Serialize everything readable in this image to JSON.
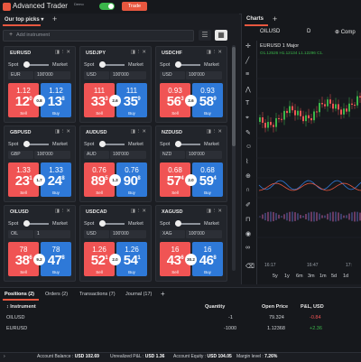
{
  "app": {
    "title": "Advanced Trader",
    "subtitle": "Demo",
    "trade_label": "Trade"
  },
  "watchlist": {
    "tab_label": "Our top picks",
    "add_tab": "+",
    "search_placeholder": "Add instrument",
    "tiles": [
      {
        "symbol": "EURUSD",
        "spot": "Spot",
        "market": "Market",
        "instrument": "EUR",
        "quantity": "100'000",
        "sell_top": "1.12",
        "sell_big": "12",
        "sell_small": "0",
        "buy_top": "1.12",
        "buy_big": "13",
        "buy_small": "8",
        "spread": "0.8",
        "sell_label": "Sell",
        "buy_label": "Buy"
      },
      {
        "symbol": "USDJPY",
        "spot": "Spot",
        "market": "Market",
        "instrument": "USD",
        "quantity": "100'000",
        "sell_top": "111",
        "sell_big": "33",
        "sell_small": "3",
        "buy_top": "111",
        "buy_big": "35",
        "buy_small": "9",
        "spread": "2.6",
        "sell_label": "Sell",
        "buy_label": "Buy"
      },
      {
        "symbol": "USDCHF",
        "spot": "Spot",
        "market": "Market",
        "instrument": "USD",
        "quantity": "100'000",
        "sell_top": "0.93",
        "sell_big": "56",
        "sell_small": "3",
        "buy_top": "0.93",
        "buy_big": "58",
        "buy_small": "9",
        "spread": "2.6",
        "sell_label": "Sell",
        "buy_label": "Buy"
      },
      {
        "symbol": "GBPUSD",
        "spot": "Spot",
        "market": "Market",
        "instrument": "GBP",
        "quantity": "100'000",
        "sell_top": "1.33",
        "sell_big": "23",
        "sell_small": "1",
        "buy_top": "1.33",
        "buy_big": "24",
        "buy_small": "8",
        "spread": "1.7",
        "sell_label": "Sell",
        "buy_label": "Buy"
      },
      {
        "symbol": "AUDUSD",
        "spot": "Spot",
        "market": "Market",
        "instrument": "AUD",
        "quantity": "100'000",
        "sell_top": "0.76",
        "sell_big": "89",
        "sell_small": "5",
        "buy_top": "0.76",
        "buy_big": "90",
        "buy_small": "8",
        "spread": "1.3",
        "sell_label": "Sell",
        "buy_label": "Buy"
      },
      {
        "symbol": "NZDUSD",
        "spot": "Spot",
        "market": "Market",
        "instrument": "NZD",
        "quantity": "100'000",
        "sell_top": "0.68",
        "sell_big": "57",
        "sell_small": "4",
        "buy_top": "0.68",
        "buy_big": "59",
        "buy_small": "4",
        "spread": "2.0",
        "sell_label": "Sell",
        "buy_label": "Buy"
      },
      {
        "symbol": "OILUSD",
        "spot": "Spot",
        "market": "Market",
        "instrument": "OIL",
        "quantity": "1",
        "sell_top": "78",
        "sell_big": "38",
        "sell_small": "6",
        "buy_top": "78",
        "buy_big": "47",
        "buy_small": "8",
        "spread": "9.2",
        "sell_label": "Sell",
        "buy_label": "Buy"
      },
      {
        "symbol": "USDCAD",
        "spot": "Spot",
        "market": "Market",
        "instrument": "USD",
        "quantity": "100'000",
        "sell_top": "1.26",
        "sell_big": "52",
        "sell_small": "1",
        "buy_top": "1.26",
        "buy_big": "54",
        "buy_small": "1",
        "spread": "2.0",
        "sell_label": "Sell",
        "buy_label": "Buy"
      },
      {
        "symbol": "XAGUSD",
        "spot": "Spot",
        "market": "Market",
        "instrument": "XAG",
        "quantity": "100'000",
        "sell_top": "16",
        "sell_big": "43",
        "sell_small": "6",
        "buy_top": "16",
        "buy_big": "46",
        "buy_small": "8",
        "spread": "30.2",
        "sell_label": "Sell",
        "buy_label": "Buy"
      }
    ]
  },
  "charts": {
    "tab_label": "Charts",
    "add_tab": "+",
    "symbol": "OILUSD",
    "interval": "D",
    "compare_label": "Comp",
    "legend": "EURUSD  1  Major",
    "ohlc": "O1.12526 H1.12134 L1.12296 C1.",
    "time_labels": [
      "16:17",
      "16:47",
      "17:"
    ],
    "ranges": [
      "5y",
      "1y",
      "6m",
      "3m",
      "1m",
      "5d",
      "1d"
    ]
  },
  "bottom": {
    "tabs": [
      "Positions (2)",
      "Orders (2)",
      "Transactions (7)",
      "Journal (17)",
      "+"
    ],
    "headers": {
      "instrument": "Instrument",
      "quantity": "Quantity",
      "open_price": "Open Price",
      "pnl": "P&L, USD"
    },
    "rows": [
      {
        "instrument": "OILUSD",
        "quantity": "-1",
        "open_price": "79.324",
        "pnl": "-0.84"
      },
      {
        "instrument": "EURUSD",
        "quantity": "-1000",
        "open_price": "1.12368",
        "pnl": "+2.36"
      }
    ]
  },
  "status": {
    "balance_label": "Account Balance :",
    "balance": "USD 102.69",
    "upnl_label": "Unrealized P&L :",
    "upnl": "USD 1.36",
    "equity_label": "Account Equity :",
    "equity": "USD 104.05",
    "margin_label": "Margin level :",
    "margin": "7.26%"
  },
  "colors": {
    "accent": "#e8573f",
    "sell": "#f05454",
    "buy": "#2e79d8",
    "positive": "#3ab54a"
  }
}
